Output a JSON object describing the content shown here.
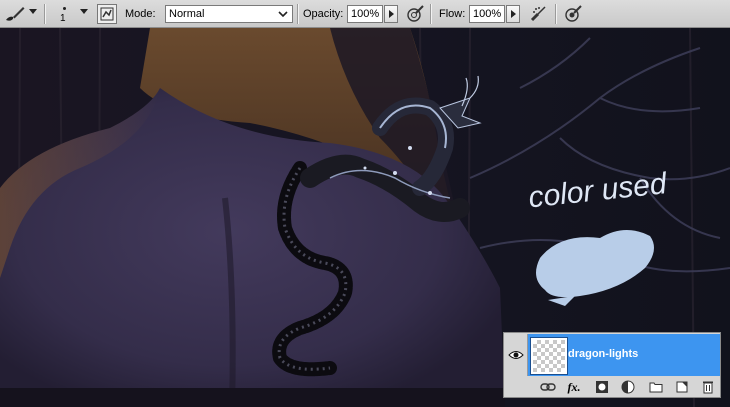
{
  "options_bar": {
    "brush_size": "1",
    "mode_label": "Mode:",
    "mode_value": "Normal",
    "opacity_label": "Opacity:",
    "opacity_value": "100%",
    "flow_label": "Flow:",
    "flow_value": "100%"
  },
  "canvas": {
    "annotation_text": "color used",
    "swatch_color": "#b8cde8"
  },
  "layers_panel": {
    "layer_name": "dragon-lights",
    "selected_row_color": "#3d95f0",
    "footer_icons": [
      "link-layers-icon",
      "fx-icon",
      "layer-mask-icon",
      "adjustment-layer-icon",
      "group-folder-icon",
      "new-layer-icon",
      "trash-icon"
    ],
    "fx_label": "fx."
  }
}
